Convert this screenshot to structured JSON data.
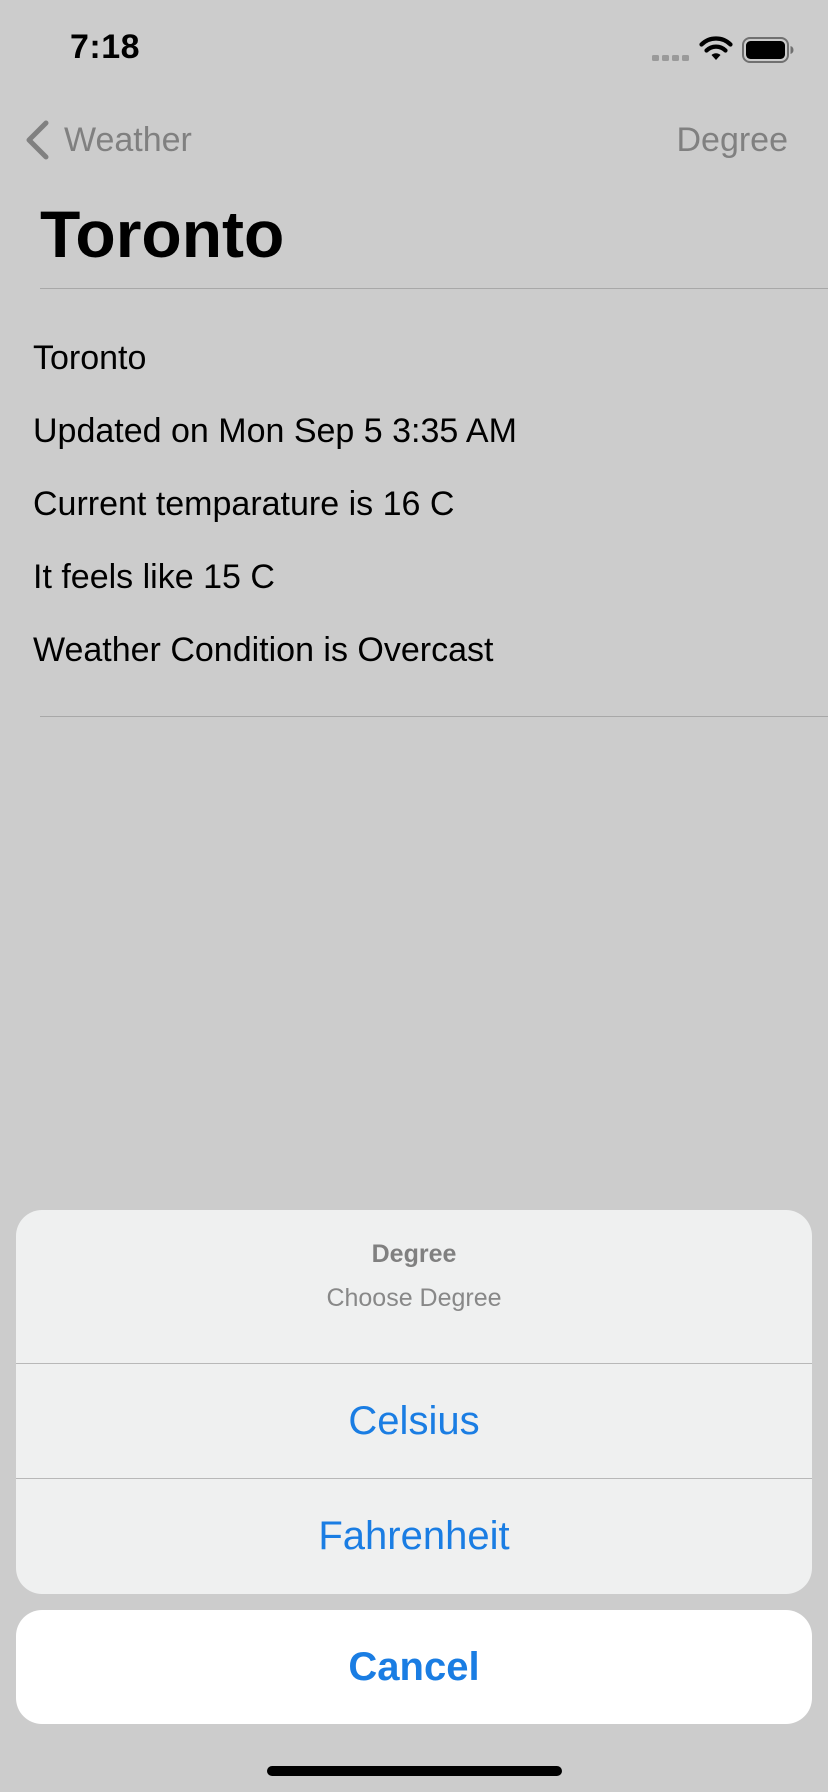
{
  "status_bar": {
    "time": "7:18"
  },
  "nav": {
    "back_label": "Weather",
    "right_label": "Degree",
    "title": "Toronto"
  },
  "info": {
    "rows": [
      "Toronto",
      "Updated on Mon Sep 5 3:35 AM",
      "Current temparature is 16 C",
      "It feels like 15 C",
      "Weather Condition is Overcast"
    ]
  },
  "action_sheet": {
    "title": "Degree",
    "message": "Choose Degree",
    "actions": [
      "Celsius",
      "Fahrenheit"
    ],
    "cancel_label": "Cancel"
  },
  "icons": {
    "back": "chevron-left-icon",
    "signal": "cellular-signal-icon",
    "wifi": "wifi-icon",
    "battery": "battery-icon"
  },
  "colors": {
    "accent": "#1a7de3",
    "dim_overlay_background": "#cccccc",
    "sheet_background": "#eff0f0"
  }
}
